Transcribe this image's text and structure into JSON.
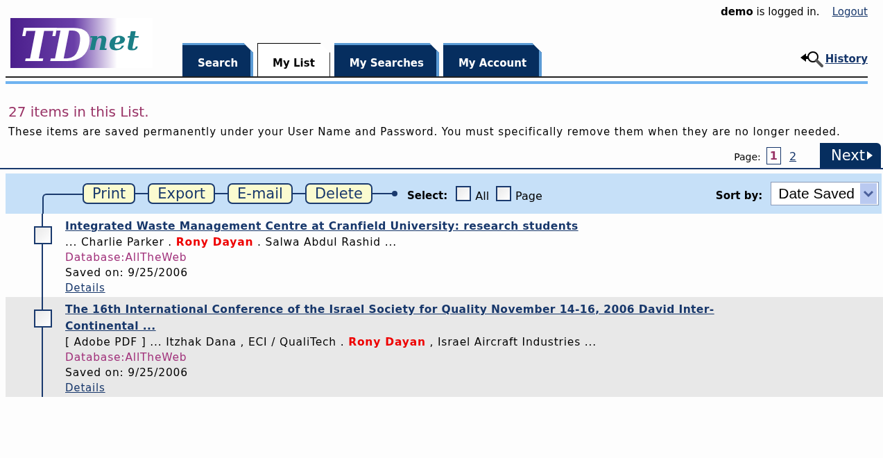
{
  "logo": {
    "part1": "TD",
    "part2": "net"
  },
  "user": {
    "name": "demo",
    "status": "is logged in.",
    "logout": "Logout"
  },
  "tabs": [
    {
      "label": "Search",
      "selected": false
    },
    {
      "label": "My List",
      "selected": true
    },
    {
      "label": "My Searches",
      "selected": false
    },
    {
      "label": "My Account",
      "selected": false
    }
  ],
  "history": "History",
  "heading": "27 items in this List.",
  "description": "These items are saved permanently under your User Name and Password. You must specifically remove them when they are no longer needed.",
  "pager": {
    "label": "Page:",
    "pages": [
      {
        "label": "1",
        "selected": true
      },
      {
        "label": "2",
        "selected": false
      }
    ],
    "next": "Next"
  },
  "toolbar": {
    "buttons": [
      "Print",
      "Export",
      "E-mail",
      "Delete"
    ],
    "select_label": "Select:",
    "select_options": [
      {
        "label": "All",
        "checked": false
      },
      {
        "label": "Page",
        "checked": false
      }
    ],
    "sort_label": "Sort by:",
    "sort_value": "Date Saved"
  },
  "items": [
    {
      "title": "Integrated Waste Management Centre at Cranfield University: research students",
      "snippet": "... Charlie Parker . **Rony Dayan** . Salwa Abdul Rashid ...",
      "database": "Database:AllTheWeb",
      "saved": "Saved on: 9/25/2006",
      "details": "Details",
      "checked": false
    },
    {
      "title": "The 16th International Conference of the Israel Society for Quality November 14-16, 2006 David Inter-Continental ...",
      "snippet": "[ Adobe PDF ] ... Itzhak Dana , ECI / QualiTech . **Rony Dayan** , Israel Aircraft Industries ...",
      "database": "Database:AllTheWeb",
      "saved": "Saved on: 9/25/2006",
      "details": "Details",
      "checked": false
    }
  ]
}
